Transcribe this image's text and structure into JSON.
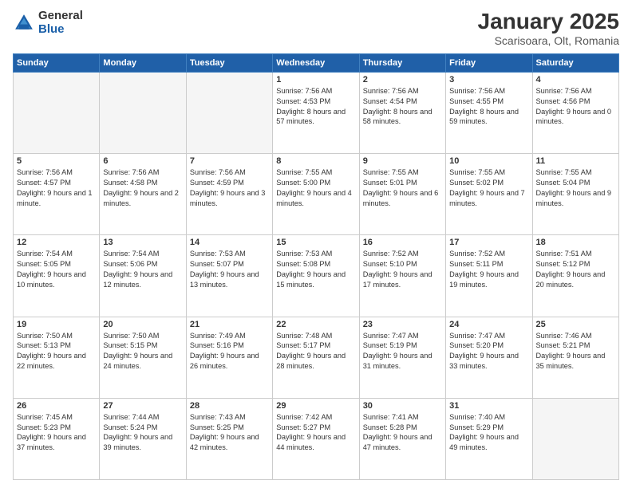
{
  "logo": {
    "general": "General",
    "blue": "Blue"
  },
  "header": {
    "title": "January 2025",
    "subtitle": "Scarisoara, Olt, Romania"
  },
  "weekdays": [
    "Sunday",
    "Monday",
    "Tuesday",
    "Wednesday",
    "Thursday",
    "Friday",
    "Saturday"
  ],
  "weeks": [
    [
      {
        "day": "",
        "info": ""
      },
      {
        "day": "",
        "info": ""
      },
      {
        "day": "",
        "info": ""
      },
      {
        "day": "1",
        "info": "Sunrise: 7:56 AM\nSunset: 4:53 PM\nDaylight: 8 hours and 57 minutes."
      },
      {
        "day": "2",
        "info": "Sunrise: 7:56 AM\nSunset: 4:54 PM\nDaylight: 8 hours and 58 minutes."
      },
      {
        "day": "3",
        "info": "Sunrise: 7:56 AM\nSunset: 4:55 PM\nDaylight: 8 hours and 59 minutes."
      },
      {
        "day": "4",
        "info": "Sunrise: 7:56 AM\nSunset: 4:56 PM\nDaylight: 9 hours and 0 minutes."
      }
    ],
    [
      {
        "day": "5",
        "info": "Sunrise: 7:56 AM\nSunset: 4:57 PM\nDaylight: 9 hours and 1 minute."
      },
      {
        "day": "6",
        "info": "Sunrise: 7:56 AM\nSunset: 4:58 PM\nDaylight: 9 hours and 2 minutes."
      },
      {
        "day": "7",
        "info": "Sunrise: 7:56 AM\nSunset: 4:59 PM\nDaylight: 9 hours and 3 minutes."
      },
      {
        "day": "8",
        "info": "Sunrise: 7:55 AM\nSunset: 5:00 PM\nDaylight: 9 hours and 4 minutes."
      },
      {
        "day": "9",
        "info": "Sunrise: 7:55 AM\nSunset: 5:01 PM\nDaylight: 9 hours and 6 minutes."
      },
      {
        "day": "10",
        "info": "Sunrise: 7:55 AM\nSunset: 5:02 PM\nDaylight: 9 hours and 7 minutes."
      },
      {
        "day": "11",
        "info": "Sunrise: 7:55 AM\nSunset: 5:04 PM\nDaylight: 9 hours and 9 minutes."
      }
    ],
    [
      {
        "day": "12",
        "info": "Sunrise: 7:54 AM\nSunset: 5:05 PM\nDaylight: 9 hours and 10 minutes."
      },
      {
        "day": "13",
        "info": "Sunrise: 7:54 AM\nSunset: 5:06 PM\nDaylight: 9 hours and 12 minutes."
      },
      {
        "day": "14",
        "info": "Sunrise: 7:53 AM\nSunset: 5:07 PM\nDaylight: 9 hours and 13 minutes."
      },
      {
        "day": "15",
        "info": "Sunrise: 7:53 AM\nSunset: 5:08 PM\nDaylight: 9 hours and 15 minutes."
      },
      {
        "day": "16",
        "info": "Sunrise: 7:52 AM\nSunset: 5:10 PM\nDaylight: 9 hours and 17 minutes."
      },
      {
        "day": "17",
        "info": "Sunrise: 7:52 AM\nSunset: 5:11 PM\nDaylight: 9 hours and 19 minutes."
      },
      {
        "day": "18",
        "info": "Sunrise: 7:51 AM\nSunset: 5:12 PM\nDaylight: 9 hours and 20 minutes."
      }
    ],
    [
      {
        "day": "19",
        "info": "Sunrise: 7:50 AM\nSunset: 5:13 PM\nDaylight: 9 hours and 22 minutes."
      },
      {
        "day": "20",
        "info": "Sunrise: 7:50 AM\nSunset: 5:15 PM\nDaylight: 9 hours and 24 minutes."
      },
      {
        "day": "21",
        "info": "Sunrise: 7:49 AM\nSunset: 5:16 PM\nDaylight: 9 hours and 26 minutes."
      },
      {
        "day": "22",
        "info": "Sunrise: 7:48 AM\nSunset: 5:17 PM\nDaylight: 9 hours and 28 minutes."
      },
      {
        "day": "23",
        "info": "Sunrise: 7:47 AM\nSunset: 5:19 PM\nDaylight: 9 hours and 31 minutes."
      },
      {
        "day": "24",
        "info": "Sunrise: 7:47 AM\nSunset: 5:20 PM\nDaylight: 9 hours and 33 minutes."
      },
      {
        "day": "25",
        "info": "Sunrise: 7:46 AM\nSunset: 5:21 PM\nDaylight: 9 hours and 35 minutes."
      }
    ],
    [
      {
        "day": "26",
        "info": "Sunrise: 7:45 AM\nSunset: 5:23 PM\nDaylight: 9 hours and 37 minutes."
      },
      {
        "day": "27",
        "info": "Sunrise: 7:44 AM\nSunset: 5:24 PM\nDaylight: 9 hours and 39 minutes."
      },
      {
        "day": "28",
        "info": "Sunrise: 7:43 AM\nSunset: 5:25 PM\nDaylight: 9 hours and 42 minutes."
      },
      {
        "day": "29",
        "info": "Sunrise: 7:42 AM\nSunset: 5:27 PM\nDaylight: 9 hours and 44 minutes."
      },
      {
        "day": "30",
        "info": "Sunrise: 7:41 AM\nSunset: 5:28 PM\nDaylight: 9 hours and 47 minutes."
      },
      {
        "day": "31",
        "info": "Sunrise: 7:40 AM\nSunset: 5:29 PM\nDaylight: 9 hours and 49 minutes."
      },
      {
        "day": "",
        "info": ""
      }
    ]
  ]
}
